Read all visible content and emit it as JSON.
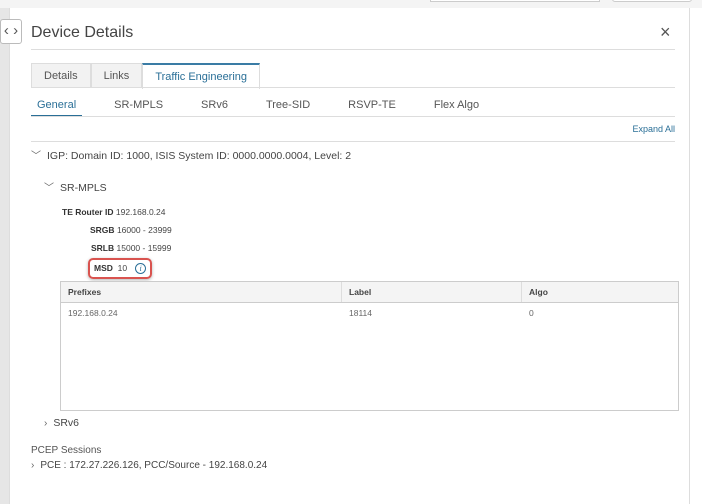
{
  "header": {
    "title": "Device Details",
    "close": "×",
    "toggle": "⟨⟩"
  },
  "tabs": [
    {
      "label": "Details"
    },
    {
      "label": "Links"
    },
    {
      "label": "Traffic Engineering",
      "active": true
    }
  ],
  "subtabs": [
    {
      "label": "General",
      "active": true
    },
    {
      "label": "SR-MPLS"
    },
    {
      "label": "SRv6"
    },
    {
      "label": "Tree-SID"
    },
    {
      "label": "RSVP-TE"
    },
    {
      "label": "Flex Algo"
    }
  ],
  "expand_all": "Expand All",
  "igp": "IGP: Domain ID: 1000, ISIS System ID: 0000.0000.0004, Level: 2",
  "sr_mpls": {
    "title": "SR-MPLS",
    "te_router_id": {
      "label": "TE Router ID",
      "value": "192.168.0.24"
    },
    "srgb": {
      "label": "SRGB",
      "value": "16000 - 23999"
    },
    "srlb": {
      "label": "SRLB",
      "value": "15000 - 15999"
    },
    "msd": {
      "label": "MSD",
      "value": "10"
    }
  },
  "table": {
    "headers": [
      "Prefixes",
      "Label",
      "Algo"
    ],
    "rows": [
      [
        "192.168.0.24",
        "18114",
        "0"
      ]
    ]
  },
  "srv6": "SRv6",
  "pcep": {
    "title": "PCEP Sessions",
    "item": "PCE : 172.27.226.126, PCC/Source - 192.168.0.24"
  },
  "colors": {
    "accent": "#2a6f97",
    "highlight": "#d9534f"
  }
}
